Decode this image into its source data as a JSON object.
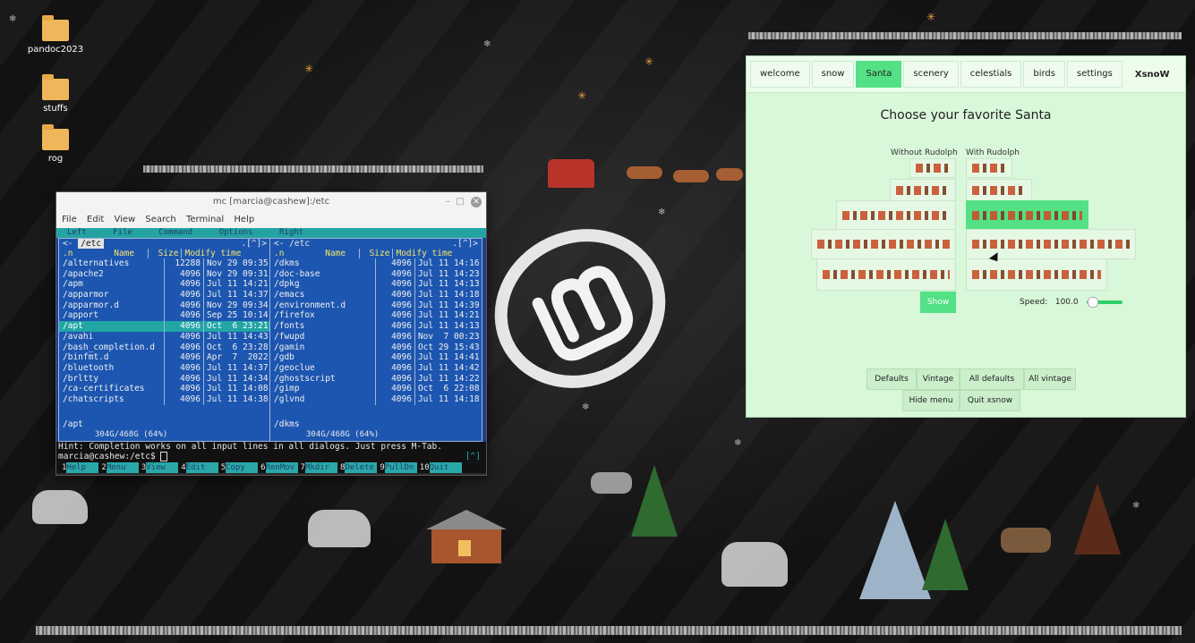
{
  "desktop": {
    "icons": [
      {
        "label": "pandoc2023"
      },
      {
        "label": "stuffs"
      },
      {
        "label": "rog"
      }
    ]
  },
  "terminal": {
    "title": "mc [marcia@cashew]:/etc",
    "window_controls": {
      "minimize": "–",
      "maximize": "□",
      "close": "✕"
    },
    "menu": [
      "File",
      "Edit",
      "View",
      "Search",
      "Terminal",
      "Help"
    ],
    "mc_menu": [
      "Left",
      "File",
      "Command",
      "Options",
      "Right"
    ],
    "left_panel": {
      "path": "/etc",
      "indicator": ".[^]>",
      "headers": {
        "name": "Name",
        "size": "Size",
        "time": "Modify time",
        "sort": ".n"
      },
      "rows": [
        {
          "name": "/alternatives",
          "size": "12288",
          "time": "Nov 29 09:35"
        },
        {
          "name": "/apache2",
          "size": "4096",
          "time": "Nov 29 09:31"
        },
        {
          "name": "/apm",
          "size": "4096",
          "time": "Jul 11 14:21"
        },
        {
          "name": "/apparmor",
          "size": "4096",
          "time": "Jul 11 14:37"
        },
        {
          "name": "/apparmor.d",
          "size": "4096",
          "time": "Nov 29 09:34"
        },
        {
          "name": "/apport",
          "size": "4096",
          "time": "Sep 25 10:14"
        },
        {
          "name": "/apt",
          "size": "4096",
          "time": "Oct  6 23:21"
        },
        {
          "name": "/avahi",
          "size": "4096",
          "time": "Jul 11 14:43"
        },
        {
          "name": "/bash_completion.d",
          "size": "4096",
          "time": "Oct  6 23:28"
        },
        {
          "name": "/binfmt.d",
          "size": "4096",
          "time": "Apr  7  2022"
        },
        {
          "name": "/bluetooth",
          "size": "4096",
          "time": "Jul 11 14:37"
        },
        {
          "name": "/brltty",
          "size": "4096",
          "time": "Jul 11 14:34"
        },
        {
          "name": "/ca-certificates",
          "size": "4096",
          "time": "Jul 11 14:08"
        },
        {
          "name": "/chatscripts",
          "size": "4096",
          "time": "Jul 11 14:38"
        }
      ],
      "selected_index": 6,
      "mini_status": "/apt",
      "footer": "304G/468G (64%)"
    },
    "right_panel": {
      "path": "/etc",
      "indicator": ".[^]>",
      "headers": {
        "name": "Name",
        "size": "Size",
        "time": "Modify time",
        "sort": ".n"
      },
      "rows": [
        {
          "name": "/dkms",
          "size": "4096",
          "time": "Jul 11 14:16"
        },
        {
          "name": "/doc-base",
          "size": "4096",
          "time": "Jul 11 14:23"
        },
        {
          "name": "/dpkg",
          "size": "4096",
          "time": "Jul 11 14:13"
        },
        {
          "name": "/emacs",
          "size": "4096",
          "time": "Jul 11 14:18"
        },
        {
          "name": "/environment.d",
          "size": "4096",
          "time": "Jul 11 14:39"
        },
        {
          "name": "/firefox",
          "size": "4096",
          "time": "Jul 11 14:21"
        },
        {
          "name": "/fonts",
          "size": "4096",
          "time": "Jul 11 14:13"
        },
        {
          "name": "/fwupd",
          "size": "4096",
          "time": "Nov  7 00:23"
        },
        {
          "name": "/gamin",
          "size": "4096",
          "time": "Oct 29 15:43"
        },
        {
          "name": "/gdb",
          "size": "4096",
          "time": "Jul 11 14:41"
        },
        {
          "name": "/geoclue",
          "size": "4096",
          "time": "Jul 11 14:42"
        },
        {
          "name": "/ghostscript",
          "size": "4096",
          "time": "Jul 11 14:22"
        },
        {
          "name": "/gimp",
          "size": "4096",
          "time": "Oct  6 22:08"
        },
        {
          "name": "/glvnd",
          "size": "4096",
          "time": "Jul 11 14:18"
        }
      ],
      "mini_status": "/dkms",
      "footer": "304G/468G (64%)"
    },
    "hint": "Hint: Completion works on all input lines in all dialogs. Just press M-Tab.",
    "prompt": "marcia@cashew:/etc$",
    "prompt_indicator": "[^]",
    "fkeys": [
      {
        "n": "1",
        "label": "Help"
      },
      {
        "n": "2",
        "label": "Menu"
      },
      {
        "n": "3",
        "label": "View"
      },
      {
        "n": "4",
        "label": "Edit"
      },
      {
        "n": "5",
        "label": "Copy"
      },
      {
        "n": "6",
        "label": "RenMov"
      },
      {
        "n": "7",
        "label": "Mkdir"
      },
      {
        "n": "8",
        "label": "Delete"
      },
      {
        "n": "9",
        "label": "PullDn"
      },
      {
        "n": "10",
        "label": "Quit"
      }
    ]
  },
  "xsnow": {
    "tabs": [
      "welcome",
      "snow",
      "Santa",
      "scenery",
      "celestials",
      "birds",
      "settings"
    ],
    "active_tab": "Santa",
    "brand": "XsnoW",
    "window_controls": {
      "minimize": "–",
      "maximize": "□",
      "close": "✕"
    },
    "heading": "Choose your favorite Santa",
    "col_without": "Without Rudolph",
    "col_with": "With Rudolph",
    "show_button": "Show",
    "speed_label": "Speed:",
    "speed_value": "100.0",
    "speed_fraction": 0.05,
    "buttons_row1": [
      "Defaults",
      "Vintage",
      "All defaults",
      "All vintage"
    ],
    "buttons_row2": [
      "Hide menu",
      "Quit xsnow"
    ]
  },
  "colors": {
    "mc_blue": "#1d56b0",
    "mc_cyan": "#25a3a3",
    "xsnow_green": "#54e084",
    "xsnow_bg": "#d9f7d9"
  }
}
